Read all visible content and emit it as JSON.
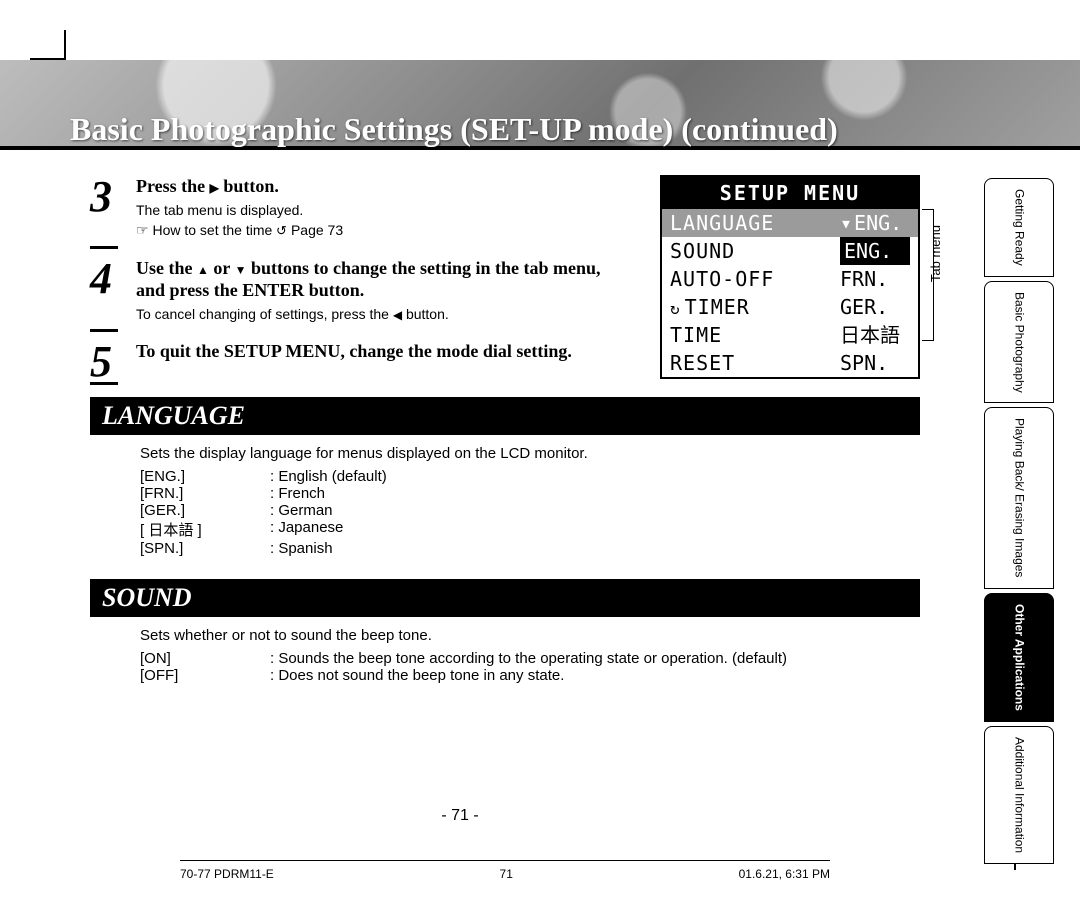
{
  "header": {
    "page_title": "Basic Photographic Settings (SET-UP mode) (continued)"
  },
  "steps": {
    "s3": {
      "num": "3",
      "head_a": "Press the ",
      "head_b": " button.",
      "sub1": "The tab menu is displayed.",
      "sub2_a": " How to set the time ",
      "sub2_b": " Page 73"
    },
    "s4": {
      "num": "4",
      "head_a": "Use the ",
      "head_b": " or ",
      "head_c": " buttons to change the setting in the tab menu, and press the ENTER button.",
      "sub_a": "To cancel changing of settings, press the ",
      "sub_b": " button."
    },
    "s5": {
      "num": "5",
      "head": "To quit the SETUP MENU, change the mode dial setting."
    }
  },
  "screen": {
    "title": "SETUP MENU",
    "rows": [
      {
        "left": "LANGUAGE",
        "right": "ENG.",
        "hl": true,
        "arrow": true
      },
      {
        "left": "SOUND",
        "right": "ENG.",
        "sel": true
      },
      {
        "left": "AUTO-OFF",
        "right": "FRN."
      },
      {
        "left": "TIMER",
        "right": "GER.",
        "timer": true
      },
      {
        "left": "TIME",
        "right": "日本語"
      },
      {
        "left": "RESET",
        "right": "SPN."
      }
    ],
    "tab_menu_label": "Tab menu"
  },
  "sections": {
    "language": {
      "title": "LANGUAGE",
      "intro": "Sets the display language for menus displayed on the LCD monitor.",
      "rows": [
        {
          "code": "[ENG.]",
          "desc": ": English (default)"
        },
        {
          "code": "[FRN.]",
          "desc": ": French"
        },
        {
          "code": "[GER.]",
          "desc": ": German"
        },
        {
          "code": "[ 日本語 ]",
          "desc": ": Japanese"
        },
        {
          "code": "[SPN.]",
          "desc": ": Spanish"
        }
      ]
    },
    "sound": {
      "title": "SOUND",
      "intro": "Sets whether or not to sound the beep tone.",
      "rows": [
        {
          "code": "[ON]",
          "desc": ": Sounds the beep tone according to the operating state or operation. (default)"
        },
        {
          "code": "[OFF]",
          "desc": ": Does not sound the beep tone in any state."
        }
      ]
    }
  },
  "side_tabs": [
    {
      "label": "Getting Ready",
      "active": false
    },
    {
      "label": "Basic\nPhotography",
      "active": false
    },
    {
      "label": "Playing Back/\nErasing Images",
      "active": false
    },
    {
      "label": "Other\nApplications",
      "active": true
    },
    {
      "label": "Additional\nInformation",
      "active": false
    }
  ],
  "page_number": "- 71 -",
  "footer": {
    "left": "70-77 PDRM11-E",
    "center": "71",
    "right": "01.6.21, 6:31 PM"
  }
}
